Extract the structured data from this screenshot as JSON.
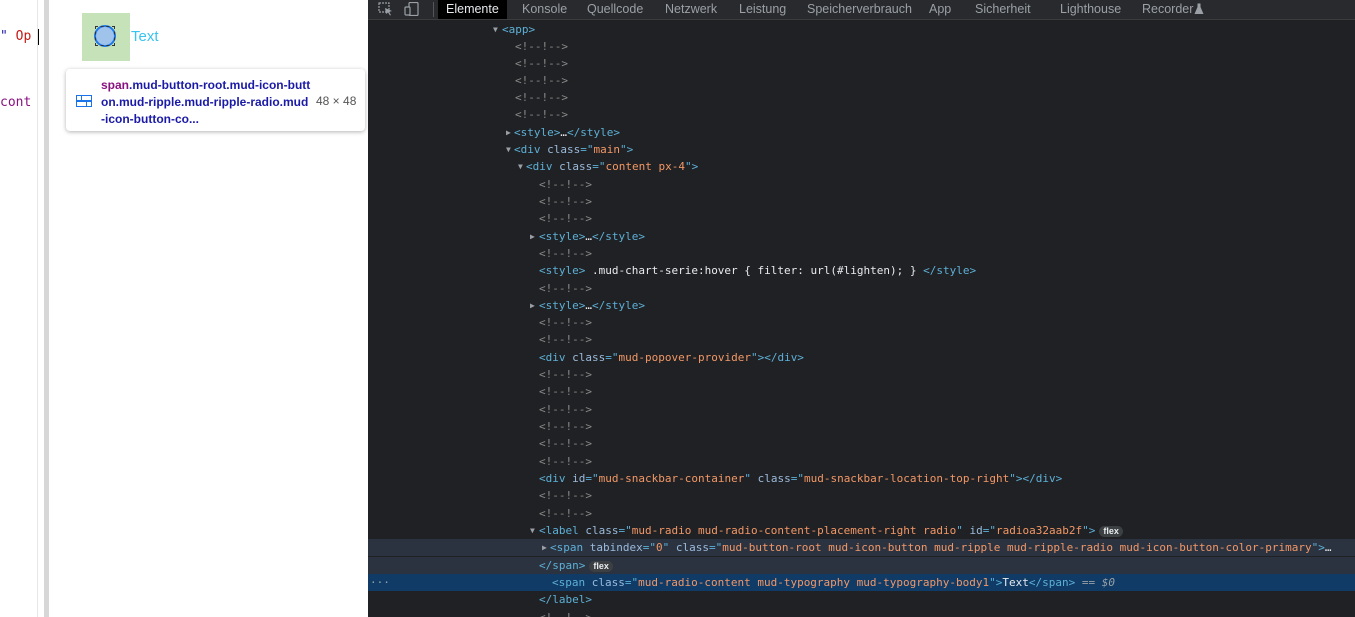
{
  "page": {
    "code_line1_text": "\" ",
    "code_line1_red": "Op",
    "code_line2": "cont",
    "radio_label": "Text"
  },
  "tooltip": {
    "tag": "span",
    "classes": ".mud-button-root.mud-icon-button.mud-ripple.mud-ripple-radio.mud-icon-button-co...",
    "size": "48 × 48"
  },
  "devtools": {
    "tabs": [
      {
        "label": "Elemente"
      },
      {
        "label": "Konsole"
      },
      {
        "label": "Quellcode"
      },
      {
        "label": "Netzwerk"
      },
      {
        "label": "Leistung"
      },
      {
        "label": "Speicherverbrauch"
      },
      {
        "label": "App"
      },
      {
        "label": "Sicherheit"
      },
      {
        "label": "Lighthouse"
      },
      {
        "label": "Recorder"
      }
    ],
    "dom": {
      "app_open": "<app>",
      "comment": "<!--!-->",
      "style_collapsed": "…",
      "main_class": "main",
      "content_class": "content px-4",
      "chart_style_rule": " .mud-chart-serie:hover { filter: url(#lighten); } ",
      "popover_class": "mud-popover-provider",
      "snackbar_id": "mud-snackbar-container",
      "snackbar_class": "mud-snackbar-location-top-right",
      "label_class": "mud-radio mud-radio-content-placement-right radio",
      "label_id": "radioa32aab2f",
      "badge_flex": "flex",
      "span_tabindex": "0",
      "span_button_class": "mud-button-root mud-icon-button mud-ripple mud-ripple-radio mud-icon-button-color-primary",
      "span_content_class": "mud-radio-content mud-typography mud-typography-body1",
      "span_content_text": "Text",
      "selected_marker": " == ",
      "selected_var": "$0",
      "ellipsis": "…",
      "row_dots": "···"
    }
  }
}
